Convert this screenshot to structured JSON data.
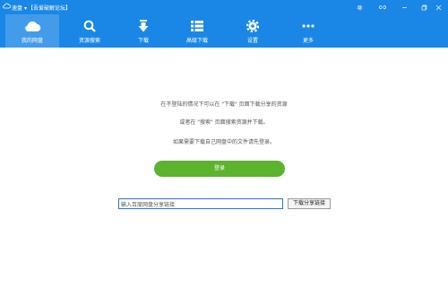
{
  "window": {
    "app_title": "速盘",
    "dropdown_glyph": "▾",
    "forum_tag": "【吾爱破解论坛】",
    "controls": [
      {
        "name": "settings-icon",
        "glyph": "⚙"
      },
      {
        "name": "minimize-icon",
        "glyph": "–"
      },
      {
        "name": "restore-icon",
        "glyph": "❐"
      },
      {
        "name": "close-icon",
        "glyph": "✕"
      }
    ]
  },
  "toolbar": {
    "items": [
      {
        "label": "我的网盘",
        "icon": "cloud-icon",
        "active": true
      },
      {
        "label": "资源搜索",
        "icon": "search-icon",
        "active": false
      },
      {
        "label": "下载",
        "icon": "download-icon",
        "active": false
      },
      {
        "label": "高级下载",
        "icon": "list-icon",
        "active": false
      },
      {
        "label": "设置",
        "icon": "gear-icon",
        "active": false
      },
      {
        "label": "更多",
        "icon": "more-icon",
        "active": false
      }
    ]
  },
  "main": {
    "line1": "在不登陆的情况下可以在 \"下载\" 页面下载分享的资源",
    "line2": "或者在 \"搜索\" 页面搜索资源并下载。",
    "line3": "如果需要下载自己网盘中的文件请先登录。",
    "login_label": "登录",
    "share_input_value": "输入百度网盘分享链接",
    "share_button_label": "下载分享链接"
  },
  "colors": {
    "accent": "#1a87e6",
    "login_green": "#5cb32e"
  }
}
